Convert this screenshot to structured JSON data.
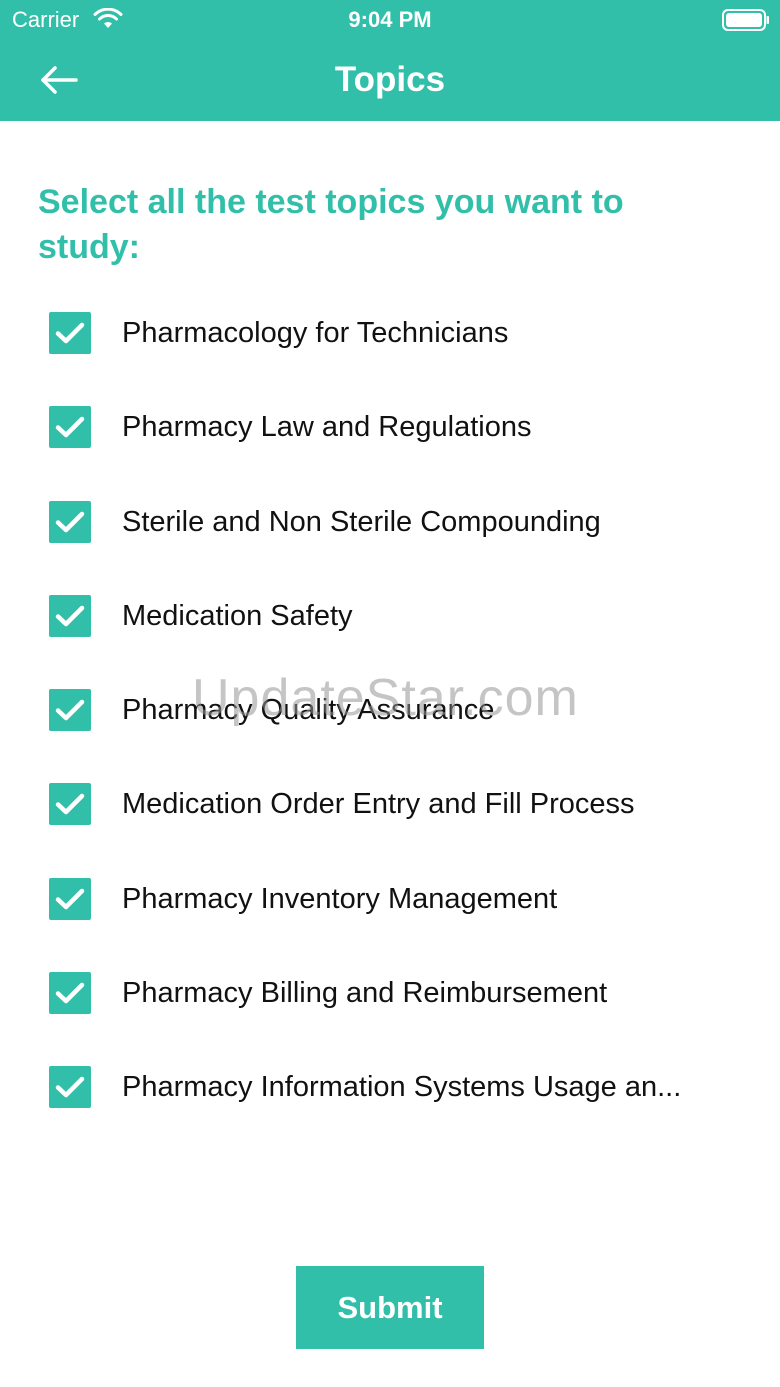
{
  "status_bar": {
    "carrier": "Carrier",
    "time": "9:04 PM"
  },
  "nav": {
    "title": "Topics",
    "back_icon": "arrow-left-icon"
  },
  "prompt": "Select all the test topics you want to study:",
  "topics": [
    {
      "label": "Pharmacology for Technicians",
      "checked": true
    },
    {
      "label": "Pharmacy Law and Regulations",
      "checked": true
    },
    {
      "label": "Sterile and Non Sterile Compounding",
      "checked": true
    },
    {
      "label": "Medication Safety",
      "checked": true
    },
    {
      "label": "Pharmacy Quality Assurance",
      "checked": true
    },
    {
      "label": "Medication Order Entry and Fill Process",
      "checked": true
    },
    {
      "label": "Pharmacy Inventory Management",
      "checked": true
    },
    {
      "label": "Pharmacy Billing and Reimbursement",
      "checked": true
    },
    {
      "label": "Pharmacy Information Systems Usage an...",
      "checked": true
    }
  ],
  "watermark": "UpdateStar.com",
  "submit_label": "Submit",
  "colors": {
    "accent": "#32bfaa",
    "text": "#111111",
    "background": "#ffffff"
  }
}
